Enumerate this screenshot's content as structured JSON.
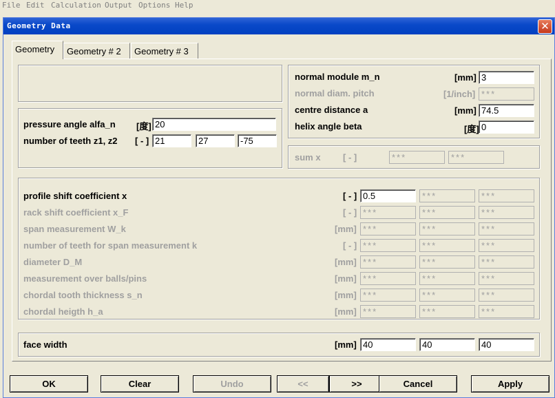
{
  "menu": [
    "File",
    "Edit",
    "Calculation",
    "Output",
    "Options",
    "Help"
  ],
  "dialog": {
    "title": "Geometry Data",
    "close_glyph": "✕"
  },
  "tabs": [
    "Geometry",
    "Geometry # 2",
    "Geometry # 3"
  ],
  "basic": {
    "pressure_angle": {
      "label": "pressure angle alfa_n",
      "unit": "[度]",
      "value": "20"
    },
    "teeth": {
      "label": "number of teeth z1, z2",
      "unit": "[ - ]",
      "values": [
        "21",
        "27",
        "-75"
      ]
    }
  },
  "module": {
    "normal_module": {
      "label": "normal module m_n",
      "unit": "[mm]",
      "value": "3"
    },
    "diam_pitch": {
      "label": "normal diam. pitch",
      "unit": "[1/inch]",
      "value": "***"
    },
    "centre_distance": {
      "label": "centre distance a",
      "unit": "[mm]",
      "value": "74.5"
    },
    "helix_angle": {
      "label": "helix angle beta",
      "unit": "[度]",
      "value": "0"
    }
  },
  "sumx": {
    "label": "sum x",
    "unit": "[ - ]",
    "values": [
      "***",
      "***"
    ]
  },
  "shift_rows": [
    {
      "label": "profile shift coefficient x",
      "unit": "[ - ]",
      "values": [
        "0.5",
        "***",
        "***"
      ]
    },
    {
      "label": "rack shift coefficient x_F",
      "unit": "[ - ]",
      "values": [
        "***",
        "***",
        "***"
      ]
    },
    {
      "label": "span measurement W_k",
      "unit": "[mm]",
      "values": [
        "***",
        "***",
        "***"
      ]
    },
    {
      "label": "number of teeth for span measurement k",
      "unit": "[ - ]",
      "values": [
        "***",
        "***",
        "***"
      ]
    },
    {
      "label": "diameter D_M",
      "unit": "[mm]",
      "values": [
        "***",
        "***",
        "***"
      ]
    },
    {
      "label": "measurement over balls/pins",
      "unit": "[mm]",
      "values": [
        "***",
        "***",
        "***"
      ]
    },
    {
      "label": "chordal tooth thickness s_n",
      "unit": "[mm]",
      "values": [
        "***",
        "***",
        "***"
      ]
    },
    {
      "label": "chordal heigth h_a",
      "unit": "[mm]",
      "values": [
        "***",
        "***",
        "***"
      ]
    }
  ],
  "face_width": {
    "label": "face width",
    "unit": "[mm]",
    "values": [
      "40",
      "40",
      "40"
    ]
  },
  "buttons": {
    "ok": "OK",
    "clear": "Clear",
    "undo": "Undo",
    "prev": "<<",
    "next": ">>",
    "cancel": "Cancel",
    "apply": "Apply"
  }
}
